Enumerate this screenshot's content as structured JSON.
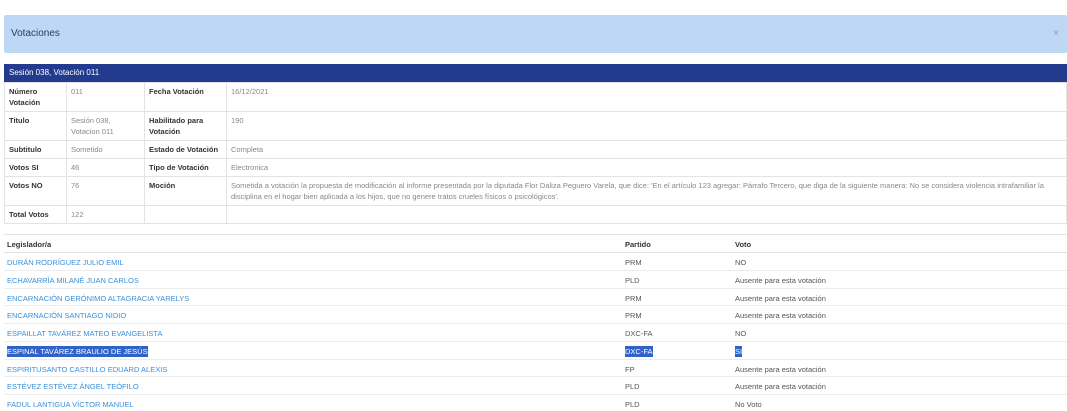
{
  "modal": {
    "title": "Votaciones",
    "close": "×"
  },
  "session": {
    "title": "Sesión 038, Votación 011"
  },
  "info": {
    "numero_label": "Número Votación",
    "numero_value": "011",
    "fecha_label": "Fecha Votación",
    "fecha_value": "16/12/2021",
    "titulo_label": "Titulo",
    "titulo_value": "Sesión 038, Votacion 011",
    "habilitado_label": "Habilitado para Votación",
    "habilitado_value": "190",
    "subtitulo_label": "Subtitulo",
    "subtitulo_value": "Sometido",
    "estado_label": "Estado de Votación",
    "estado_value": "Completa",
    "votos_si_label": "Votos SI",
    "votos_si_value": "46",
    "tipo_label": "Tipo de Votación",
    "tipo_value": "Electronica",
    "votos_no_label": "Votos NO",
    "votos_no_value": "76",
    "mocion_label": "Moción",
    "mocion_value": "Sometida a votación la propuesta de modificación al informe presentada por la diputada Flor Daliza Peguero Varela, que dice: 'En el artículo 123 agregar: Párrafo Tercero, que diga de la siguiente manera: No se considera violencia intrafamiliar la disciplina en el hogar bien aplicada a los hijos, que no genere tratos crueles físicos o psicológicos'.",
    "total_label": "Total Votos",
    "total_value": "122"
  },
  "votes": {
    "headers": {
      "legislador": "Legislador/a",
      "partido": "Partido",
      "voto": "Voto"
    },
    "rows": [
      {
        "name": "DURÁN RODRÍGUEZ JULIO EMIL",
        "party": "PRM",
        "vote": "NO"
      },
      {
        "name": "ECHAVARRÍA MILANÉ JUAN CARLOS",
        "party": "PLD",
        "vote": "Ausente para esta votación"
      },
      {
        "name": "ENCARNACIÓN GERÓNIMO ALTAGRACIA YARELYS",
        "party": "PRM",
        "vote": "Ausente para esta votación"
      },
      {
        "name": "ENCARNACIÓN SANTIAGO NIDIO",
        "party": "PRM",
        "vote": "Ausente para esta votación"
      },
      {
        "name": "ESPAILLAT TAVÁREZ MATEO EVANGELISTA",
        "party": "DXC-FA",
        "vote": "NO"
      },
      {
        "name": "ESPINAL TAVÁREZ BRAULIO DE JESÚS",
        "party": "DXC-FA",
        "vote": "SI",
        "selected": true
      },
      {
        "name": "ESPIRITUSANTO CASTILLO EDUARD ALEXIS",
        "party": "FP",
        "vote": "Ausente para esta votación"
      },
      {
        "name": "ESTÉVEZ ESTÉVEZ ÁNGEL TEÓFILO",
        "party": "PLD",
        "vote": "Ausente para esta votación"
      },
      {
        "name": "FADUL LANTIGUA VÍCTOR MANUEL",
        "party": "PLD",
        "vote": "No Voto"
      }
    ]
  }
}
